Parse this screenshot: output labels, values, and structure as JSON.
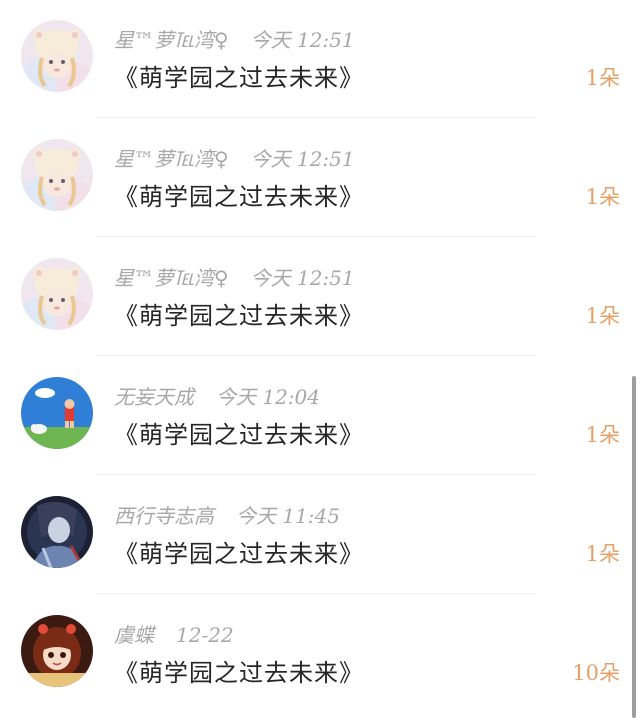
{
  "gifts": [
    {
      "user": "星™萝℡湾♀",
      "time": "今天 12:51",
      "title": "《萌学园之过去未来》",
      "count": "1朵",
      "avatar_icon": "girl-bear-hat-avatar"
    },
    {
      "user": "星™萝℡湾♀",
      "time": "今天 12:51",
      "title": "《萌学园之过去未来》",
      "count": "1朵",
      "avatar_icon": "girl-bear-hat-avatar"
    },
    {
      "user": "星™萝℡湾♀",
      "time": "今天 12:51",
      "title": "《萌学园之过去未来》",
      "count": "1朵",
      "avatar_icon": "girl-bear-hat-avatar"
    },
    {
      "user": "无妄天成",
      "time": "今天 12:04",
      "title": "《萌学园之过去未来》",
      "count": "1朵",
      "avatar_icon": "cartoon-sky-avatar"
    },
    {
      "user": "西行寺志高",
      "time": "今天 11:45",
      "title": "《萌学园之过去未来》",
      "count": "1朵",
      "avatar_icon": "dark-warrior-avatar"
    },
    {
      "user": "虞蝶",
      "time": "12-22",
      "title": "《萌学园之过去未来》",
      "count": "10朵",
      "avatar_icon": "anime-girl-avatar"
    }
  ],
  "colors": {
    "count": "#e6a066",
    "meta": "#a8a8a8",
    "title": "#262626"
  }
}
